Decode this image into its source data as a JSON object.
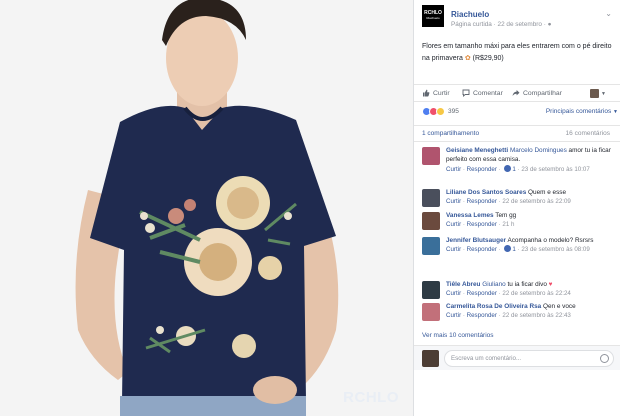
{
  "watermark": "RCHLO",
  "page": {
    "logo_text": "RCHLO",
    "logo_sub": "Riachuelo",
    "name": "Riachuelo",
    "meta": "Página curtida · 22 de setembro · ",
    "post_text": "Flores em tamanho máxi para eles entrarem com o pé direito na primavera",
    "price": "(R$29,90)"
  },
  "actions": {
    "like": "Curtir",
    "comment": "Comentar",
    "share": "Compartilhar"
  },
  "reactions": {
    "count": "395",
    "sort_label": "Principais comentários",
    "shares_label": "1 compartilhamento",
    "comments_count": "16 comentários"
  },
  "comments": [
    {
      "name": "Geisiane Meneghetti",
      "mention": "Marcelo Domingues",
      "text": " amor tu ia ficar perfeito com essa camisa.",
      "meta_like": "Curtir",
      "meta_reply": "Responder",
      "meta_likes": "1",
      "meta_date": "23 de setembro às 10:07",
      "color": "#b0546e"
    },
    {
      "name": "Liliane Dos Santos Soares",
      "mention": "",
      "text": " Quem e esse",
      "meta_like": "Curtir",
      "meta_reply": "Responder",
      "meta_likes": "",
      "meta_date": "22 de setembro às 22:09",
      "color": "#4a4f5c"
    },
    {
      "name": "Vanessa Lemes",
      "mention": "",
      "text": " Tem gg",
      "meta_like": "Curtir",
      "meta_reply": "Responder",
      "meta_likes": "",
      "meta_date": "21 h",
      "color": "#6b4a3e"
    },
    {
      "name": "Jennifer Blutsauger",
      "mention": "",
      "text": " Acompanha o modelo? Rsrsrs",
      "meta_like": "Curtir",
      "meta_reply": "Responder",
      "meta_likes": "1",
      "meta_date": "23 de setembro às 08:09",
      "color": "#3a6f9a"
    },
    {
      "name": "Tiêle Abreu",
      "mention": "Giuliano",
      "text": " tu ia ficar divo ",
      "meta_like": "Curtir",
      "meta_reply": "Responder",
      "meta_likes": "",
      "meta_date": "22 de setembro às 22:24",
      "color": "#2e3b44"
    },
    {
      "name": "Carmelita Rosa De Oliveira Rsa",
      "mention": "",
      "text": " Qen e voce",
      "meta_like": "Curtir",
      "meta_reply": "Responder",
      "meta_likes": "",
      "meta_date": "22 de setembro às 22:43",
      "color": "#c2707a"
    }
  ],
  "more_comments": "Ver mais 10 comentários",
  "write_placeholder": "Escreva um comentário...",
  "colors": {
    "link": "#365899",
    "muted": "#90949c",
    "shirt": "#1f2a4f"
  }
}
